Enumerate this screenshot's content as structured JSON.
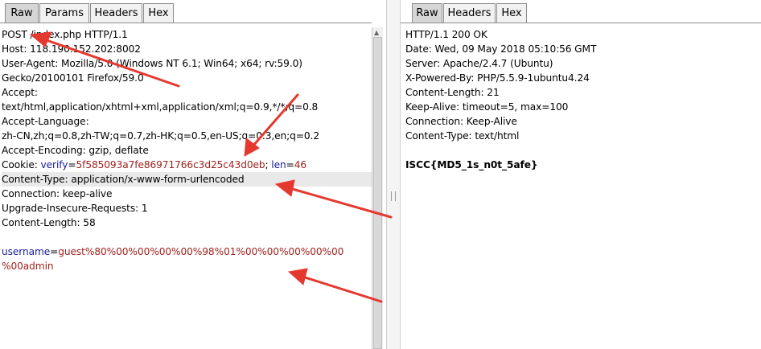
{
  "request": {
    "tabs": [
      "Raw",
      "Params",
      "Headers",
      "Hex"
    ],
    "lines": [
      "POST /index.php HTTP/1.1",
      "Host: 118.190.152.202:8002",
      "User-Agent: Mozilla/5.0 (Windows NT 6.1; Win64; x64; rv:59.0)",
      "Gecko/20100101 Firefox/59.0",
      "Accept:",
      "text/html,application/xhtml+xml,application/xml;q=0.9,*/*;q=0.8",
      "Accept-Language:",
      "zh-CN,zh;q=0.8,zh-TW;q=0.7,zh-HK;q=0.5,en-US;q=0.3,en;q=0.2",
      "Accept-Encoding: gzip, deflate"
    ],
    "cookie": {
      "label": "Cookie: ",
      "k1": "verify",
      "eq1": "=",
      "v1": "5f585093a7fe86971766c3d25c43d0eb",
      "sep": "; ",
      "k2": "len",
      "eq2": "=",
      "v2": "46"
    },
    "lines2": [
      "Content-Type: application/x-www-form-urlencoded",
      "Connection: keep-alive",
      "Upgrade-Insecure-Requests: 1",
      "Content-Length: 58"
    ],
    "body": {
      "key": "username",
      "eq": "=",
      "value_line1": "guest%80%00%00%00%00%98%01%00%00%00%00%00",
      "value_line2": "%00admin"
    }
  },
  "response": {
    "tabs": [
      "Raw",
      "Headers",
      "Hex"
    ],
    "lines": [
      "HTTP/1.1 200 OK",
      "Date: Wed, 09 May 2018 05:10:56 GMT",
      "Server: Apache/2.4.7 (Ubuntu)",
      "X-Powered-By: PHP/5.5.9-1ubuntu4.24",
      "Content-Length: 21",
      "Keep-Alive: timeout=5, max=100",
      "Connection: Keep-Alive",
      "Content-Type: text/html"
    ],
    "flag": "ISCC{MD5_1s_n0t_5afe}"
  },
  "colors": {
    "arrow": "#e5392f",
    "key": "#1b1b9c",
    "value": "#a0221e",
    "highlight": "#e9e9e9"
  }
}
